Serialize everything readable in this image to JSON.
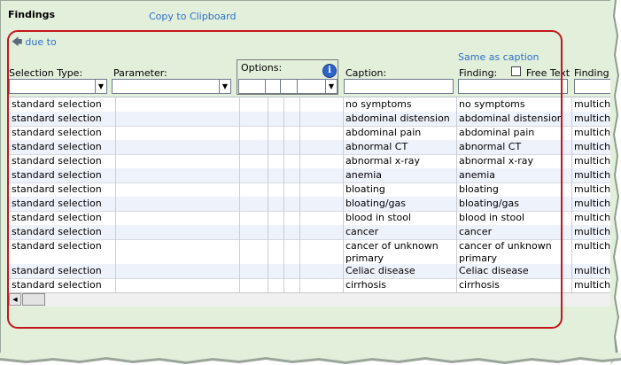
{
  "panel": {
    "title": "Findings",
    "copy_link": "Copy to Clipboard",
    "due_to_link": "due to",
    "same_as_caption_link": "Same as caption"
  },
  "columns": {
    "selection_type": "Selection Type:",
    "parameter": "Parameter:",
    "options": "Options:",
    "caption": "Caption:",
    "finding": "Finding:",
    "free_text": "Free Text",
    "finding2": "Finding"
  },
  "rows": [
    {
      "sel": "standard selection",
      "caption": "no symptoms",
      "finding": "no symptoms",
      "type": "multiche"
    },
    {
      "sel": "standard selection",
      "caption": "abdominal distension",
      "finding": "abdominal distension",
      "type": "multiche"
    },
    {
      "sel": "standard selection",
      "caption": "abdominal pain",
      "finding": "abdominal pain",
      "type": "multiche"
    },
    {
      "sel": "standard selection",
      "caption": "abnormal CT",
      "finding": "abnormal CT",
      "type": "multiche"
    },
    {
      "sel": "standard selection",
      "caption": "abnormal x-ray",
      "finding": "abnormal x-ray",
      "type": "multiche"
    },
    {
      "sel": "standard selection",
      "caption": "anemia",
      "finding": "anemia",
      "type": "multiche"
    },
    {
      "sel": "standard selection",
      "caption": "bloating",
      "finding": "bloating",
      "type": "multiche"
    },
    {
      "sel": "standard selection",
      "caption": "bloating/gas",
      "finding": "bloating/gas",
      "type": "multiche"
    },
    {
      "sel": "standard selection",
      "caption": "blood in stool",
      "finding": "blood in stool",
      "type": "multiche"
    },
    {
      "sel": "standard selection",
      "caption": "cancer",
      "finding": "cancer",
      "type": "multiche"
    },
    {
      "sel": "standard selection",
      "caption": "cancer of unknown primary",
      "finding": "cancer of unknown primary",
      "type": "multiche"
    },
    {
      "sel": "standard selection",
      "caption": "Celiac disease",
      "finding": "Celiac disease",
      "type": "multiche"
    },
    {
      "sel": "standard selection",
      "caption": "cirrhosis",
      "finding": "cirrhosis",
      "type": "multiche"
    }
  ]
}
